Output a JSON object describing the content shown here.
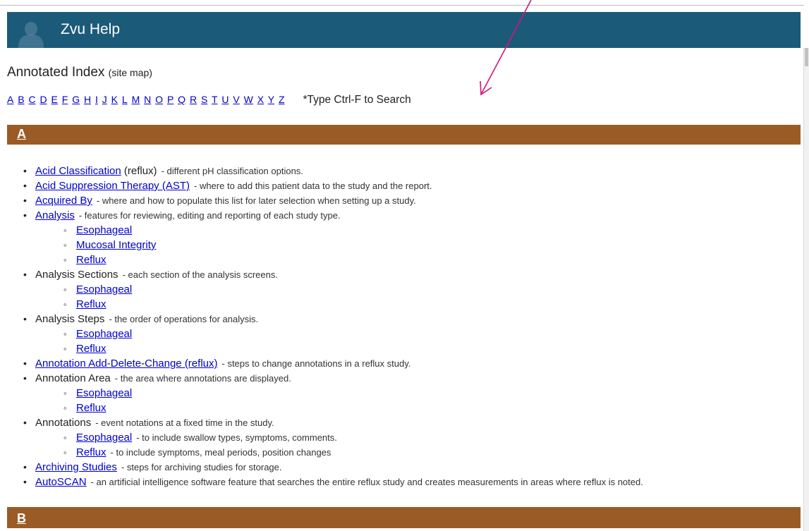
{
  "header": {
    "title": "Zvu Help"
  },
  "heading": {
    "title": "Annotated Index",
    "subtitle": "(site map)"
  },
  "letters": [
    "A",
    "B",
    "C",
    "D",
    "E",
    "F",
    "G",
    "H",
    "I",
    "J",
    "K",
    "L",
    "M",
    "N",
    "O",
    "P",
    "Q",
    "R",
    "S",
    "T",
    "U",
    "V",
    "W",
    "X",
    "Y",
    "Z"
  ],
  "search_hint": "*Type Ctrl-F to Search",
  "sections": [
    {
      "letter": "A"
    },
    {
      "letter": "B"
    }
  ],
  "entries": [
    {
      "link": "Acid Classification",
      "extra": " (reflux)",
      "desc": "- different pH classification options."
    },
    {
      "link": "Acid Suppression Therapy (AST)",
      "desc": "- where to add this patient data to the study and the report."
    },
    {
      "link": "Acquired By",
      "desc": "- where and how to populate this list for later selection when setting up a study."
    },
    {
      "link": "Analysis",
      "desc": "- features for reviewing, editing and reporting of each study type.",
      "children": [
        {
          "link": "Esophageal"
        },
        {
          "link": "Mucosal Integrity"
        },
        {
          "link": "Reflux"
        }
      ]
    },
    {
      "text": "Analysis Sections",
      "desc": "- each section of the analysis screens.",
      "children": [
        {
          "link": "Esophageal"
        },
        {
          "link": "Reflux"
        }
      ]
    },
    {
      "text": "Analysis Steps",
      "desc": "- the order of operations for analysis.",
      "children": [
        {
          "link": "Esophageal"
        },
        {
          "link": "Reflux"
        }
      ]
    },
    {
      "link": "Annotation Add-Delete-Change (reflux)",
      "desc": "- steps to change annotations in a reflux study."
    },
    {
      "text": "Annotation Area",
      "desc": "- the area where annotations are displayed.",
      "children": [
        {
          "link": "Esophageal"
        },
        {
          "link": "Reflux"
        }
      ]
    },
    {
      "text": "Annotations",
      "desc": "- event notations at a fixed time in the study.",
      "children": [
        {
          "link": "Esophageal",
          "desc": "- to include swallow types, symptoms, comments."
        },
        {
          "link": "Reflux",
          "desc": "- to include symptoms, meal periods, position changes"
        }
      ]
    },
    {
      "link": "Archiving Studies",
      "desc": "- steps for archiving studies for storage."
    },
    {
      "link": "AutoSCAN",
      "desc": "- an artificial intelligence software feature that searches the entire reflux study and creates measurements in areas where reflux is noted."
    }
  ],
  "colors": {
    "header": "#1c5a79",
    "section_bar": "#9b5b26",
    "link": "#0000cc",
    "arrow": "#d4147a"
  },
  "icons": [
    "logo-icon",
    "annotation-arrow-icon"
  ]
}
